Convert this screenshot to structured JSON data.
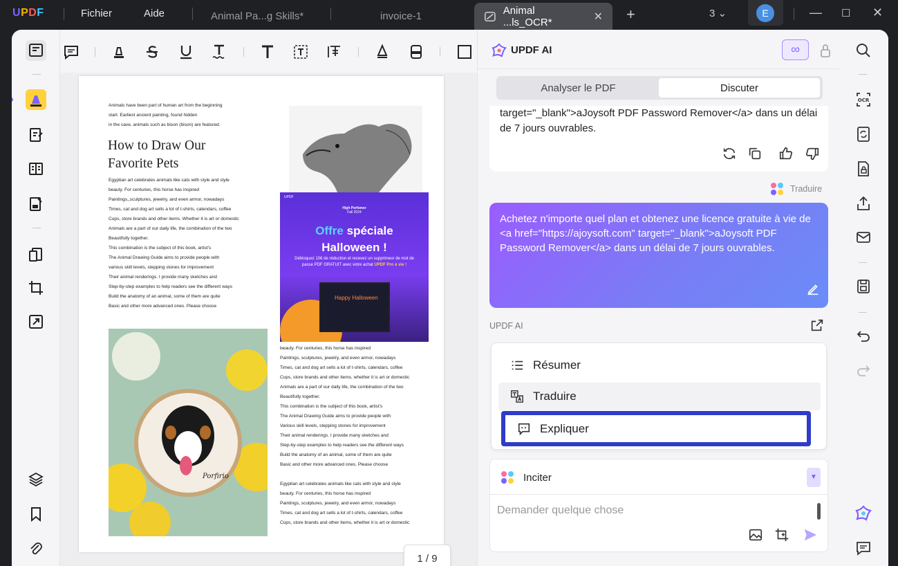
{
  "titlebar": {
    "logo": "UPDF",
    "menu": [
      "Fichier",
      "Aide"
    ],
    "tabs": [
      "Animal Pa...g Skills*",
      "invoice-1"
    ],
    "active_tab": "Animal ...ls_OCR*",
    "tab_count": "3",
    "avatar_letter": "E"
  },
  "document": {
    "intro_text": "Animals have been part of human art from the beginning\nstart. Earliest ancient painting, found hidden\nin the cave, animals such as bison (bison) are featured.",
    "title_line1": "How to Draw Our",
    "title_line2": "Favorite Pets",
    "body_left": "Egyptian art celebrates animals like cats with style and style\nbeauty. For centuries, this horse has inspired\nPaintings,,sculptures, jewelry, and even armor, nowadays\nTimes, cat and dog art sells a lot of t-shirts, calendars, coffee\nCups, store brands and other items. Whether it is art or domestic\nAnimals are a part of our daily life, the combination of the two\nBeautifully together.\nThis combination is the subject of this book, artist's\nThe Animal Drawing Guide aims to provide people with\nvarious skill levels, stepping stones for improvement\nTheir animal renderings. I provide many sketches and\nStep-by-step examples to help readers see the different ways\nBuild the anatomy of an animal, some of them are quite\nBasic and other more advanced ones. Please choose",
    "body_right": "beauty. For centuries, this horse has inspired\nPaintings, sculptures, jewelry, and even armor, nowadays\nTimes, cat and dog art sells a lot of t-shirts, calendars, coffee\nCups, store brands and other items, whether it is art or domestic\nAnimals are a part of our daily life, the combination of the two\nBeautifully together.\nThis combination is the subject of this book, artist's\nThe Animal Drawing Guide aims to provide people with\nVarious skill levels, stepping stones for improvement\nTheir animal renderings. I provide many sketches and\nStep-by-step examples to help readers see the different ways\nBuild the anatomy of an animal, some of them are quite\nBasic and other more advanced ones. Please choose\n\nEgyptian art celebrates animals like cats with style and style\nbeauty. For centuries, this horse has inspired\nPaintings, sculptures, jewelry, and even armor, nowadays\nTimes, cat and dog art sells a lot of t-shirts, calendars, coffee\nCups, store brands and other items, whether it is art or domestic",
    "promo": {
      "logo": "UPDF",
      "badge_line1": "High Perfomer",
      "badge_line2": "Fall 2024",
      "title_a": "Offre",
      "title_b": "spéciale",
      "title_line2": "Halloween !",
      "desc": "Débloquez 10€ de réduction et recevez un supprimeur de mot de passe PDF GRATUIT avec votre achat",
      "desc_highlight": "UPDF Pro à vie !",
      "screen_text": "Happy Halloween"
    },
    "photo_caption": "Porfirio",
    "page_indicator": "1 / 9"
  },
  "ai": {
    "title": "UPDF AI",
    "infinity": "∞",
    "tabs": [
      "Analyser le PDF",
      "Discuter"
    ],
    "active_tab": "Discuter",
    "reply_text": "target=\"_blank\">aJoysoft PDF Password Remover</a> dans un délai de 7 jours ouvrables.",
    "mode_tag": "Traduire",
    "user_message": "Achetez n'importe quel plan et obtenez une licence gratuite à vie de <a href=\"https://ajoysoft.com\" target=\"_blank\">aJoysoft PDF Password Remover</a> dans un délai de 7 jours ouvrables.",
    "section_label": "UPDF AI",
    "menu": [
      "Résumer",
      "Traduire",
      "Expliquer"
    ],
    "prompt_label": "Inciter",
    "input_placeholder": "Demander quelque chose"
  },
  "colors": {
    "accent": "#7b61ff",
    "selection_border": "#2f3bc9",
    "bubble_start": "#9a5cff",
    "bubble_end": "#6a8cf8"
  }
}
